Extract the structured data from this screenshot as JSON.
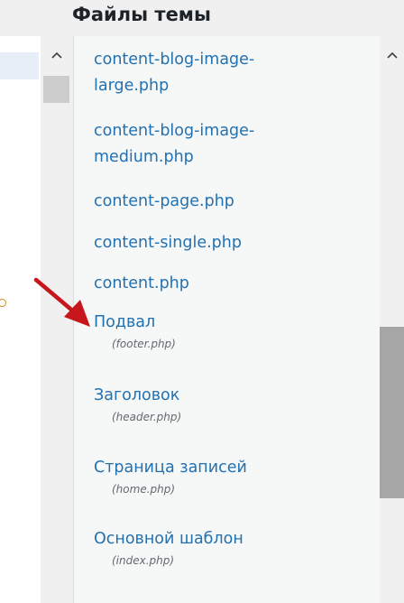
{
  "header": {
    "title": "Файлы темы"
  },
  "files": [
    {
      "label": "content-blog-image-large.php",
      "sub": ""
    },
    {
      "label": "content-blog-image-medium.php",
      "sub": ""
    },
    {
      "label": "content-page.php",
      "sub": ""
    },
    {
      "label": "content-single.php",
      "sub": ""
    },
    {
      "label": "content.php",
      "sub": ""
    },
    {
      "label": "Подвал",
      "sub": "(footer.php)"
    },
    {
      "label": "Заголовок",
      "sub": "(header.php)"
    },
    {
      "label": "Страница записей",
      "sub": "(home.php)"
    },
    {
      "label": "Основной шаблон",
      "sub": "(index.php)"
    }
  ],
  "icons": {
    "scroll_up": "chevron-up-icon",
    "annotation": "red-arrow-icon"
  },
  "colors": {
    "link": "#2271b1",
    "sub": "#646970",
    "arrow": "#c8161d"
  }
}
